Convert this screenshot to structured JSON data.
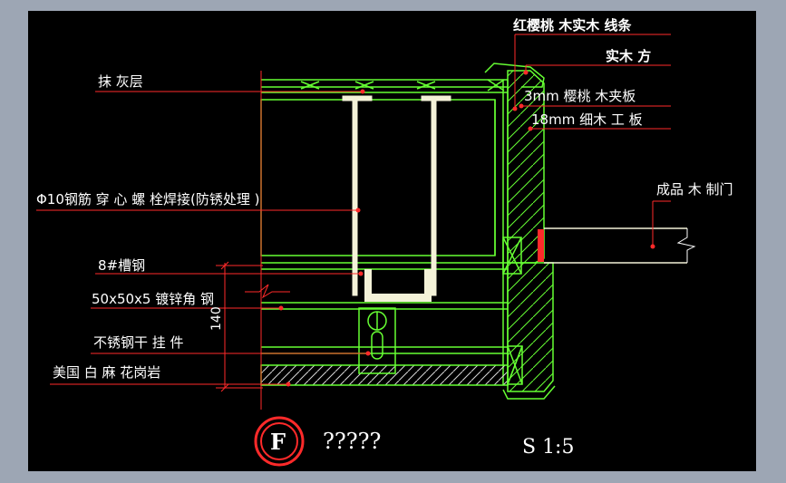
{
  "colors": {
    "background": "#000000",
    "frame": "#9da6b4",
    "leader": "#ff2a2a",
    "outline": "#66ff33",
    "wood": "#f4f2d8",
    "text": "#ffffff"
  },
  "labels": {
    "red_cherry_trim": "红樱桃 木实木 线条",
    "solid_wood_block": "实木 方",
    "cherry_veneer": "3mm 樱桃 木夹板",
    "blockboard": "18mm 细木 工 板",
    "plaster_layer": "抹 灰层",
    "door": "成品 木 制门",
    "bolt": "Φ10钢筋 穿 心 螺 栓焊接(防锈处理 )",
    "channel_steel": "8#槽钢",
    "angle_steel": "50x50x5 镀锌角 钢",
    "hanger": "不锈钢干 挂 件",
    "granite": "美国 白 麻 花岗岩"
  },
  "dimension": {
    "value": "140"
  },
  "title": {
    "badge": "F",
    "text": "?????",
    "scale": "S 1:5"
  }
}
